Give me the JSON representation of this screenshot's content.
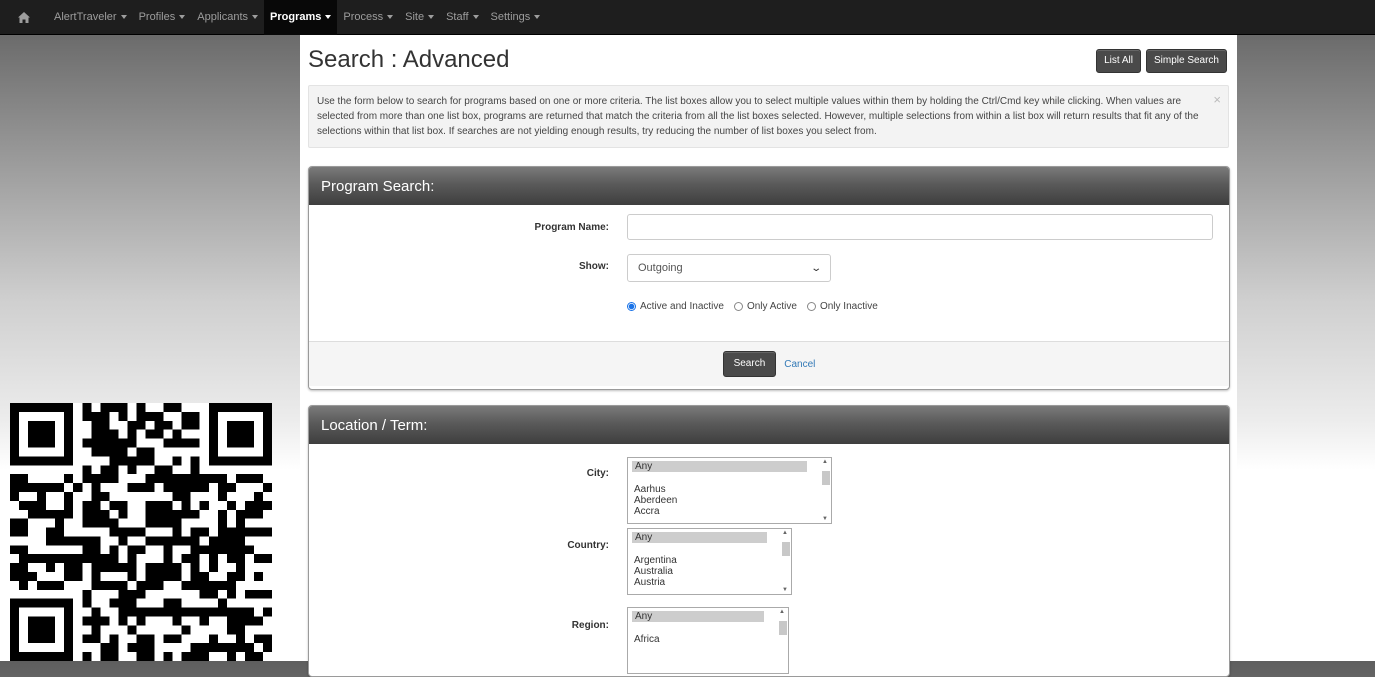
{
  "nav": {
    "items": [
      {
        "label": "AlertTraveler",
        "active": false
      },
      {
        "label": "Profiles",
        "active": false
      },
      {
        "label": "Applicants",
        "active": false
      },
      {
        "label": "Programs",
        "active": true
      },
      {
        "label": "Process",
        "active": false
      },
      {
        "label": "Site",
        "active": false
      },
      {
        "label": "Staff",
        "active": false
      },
      {
        "label": "Settings",
        "active": false
      }
    ]
  },
  "header": {
    "title": "Search : Advanced",
    "list_all": "List All",
    "simple_search": "Simple Search"
  },
  "info": {
    "text": "Use the form below to search for programs based on one or more criteria. The list boxes allow you to select multiple values within them by holding the Ctrl/Cmd key while clicking. When values are selected from more than one list box, programs are returned that match the criteria from all the list boxes selected. However, multiple selections from within a list box will return results that fit any of the selections within that list box. If searches are not yielding enough results, try reducing the number of list boxes you select from.",
    "close": "×"
  },
  "program_search": {
    "heading": "Program Search:",
    "name_label": "Program Name:",
    "name_value": "",
    "show_label": "Show:",
    "show_value": "Outgoing",
    "radios": [
      "Active and Inactive",
      "Only Active",
      "Only Inactive"
    ],
    "radio_selected": "Active and Inactive",
    "search_button": "Search",
    "cancel_link": "Cancel"
  },
  "location": {
    "heading": "Location / Term:",
    "city_label": "City:",
    "city_options": [
      "Any",
      "Aarhus",
      "Aberdeen",
      "Accra"
    ],
    "country_label": "Country:",
    "country_options": [
      "Any",
      "Argentina",
      "Australia",
      "Austria"
    ],
    "region_label": "Region:",
    "region_options": [
      "Any",
      "Africa"
    ]
  },
  "colors": {
    "navbar": "#1e1e1e",
    "panel_heading": "#5a5a5a",
    "button": "#4a4a4a",
    "link": "#337ab7",
    "radio": "#1a73e8"
  }
}
